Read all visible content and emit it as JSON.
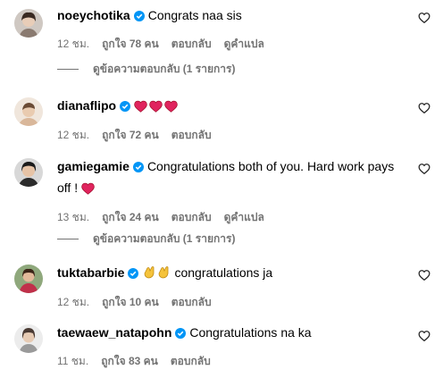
{
  "comments": [
    {
      "username": "noeychotika",
      "text": "Congrats naa sis",
      "time": "12 ชม.",
      "likes": "ถูกใจ 78 คน",
      "reply": "ตอบกลับ",
      "translate": "ดูคำแปล"
    },
    {
      "username": "dianaflipo",
      "text": "",
      "time": "12 ชม.",
      "likes": "ถูกใจ 72 คน",
      "reply": "ตอบกลับ"
    },
    {
      "username": "gamiegamie",
      "text": "Congratulations both of you. Hard work pays",
      "text2": "off !",
      "time": "13 ชม.",
      "likes": "ถูกใจ 24 คน",
      "reply": "ตอบกลับ",
      "translate": "ดูคำแปล"
    },
    {
      "username": "tuktabarbie",
      "text": "congratulations ja",
      "time": "12 ชม.",
      "likes": "ถูกใจ 10 คน",
      "reply": "ตอบกลับ"
    },
    {
      "username": "taewaew_natapohn",
      "text": "Congratulations na ka",
      "time": "11 ชม.",
      "likes": "ถูกใจ 83 คน",
      "reply": "ตอบกลับ"
    }
  ],
  "view_replies": [
    "ดูข้อความตอบกลับ (1 รายการ)",
    "ดูข้อความตอบกลับ (1 รายการ)"
  ],
  "colors": {
    "verified": "#0095f6",
    "meta": "#737373",
    "heart_emoji": "#e0245e"
  },
  "icons": {
    "like": "heart-outline-icon",
    "verified": "verified-badge-icon",
    "emoji_heart": "red-heart-emoji",
    "emoji_clap": "clapping-hands-emoji"
  }
}
